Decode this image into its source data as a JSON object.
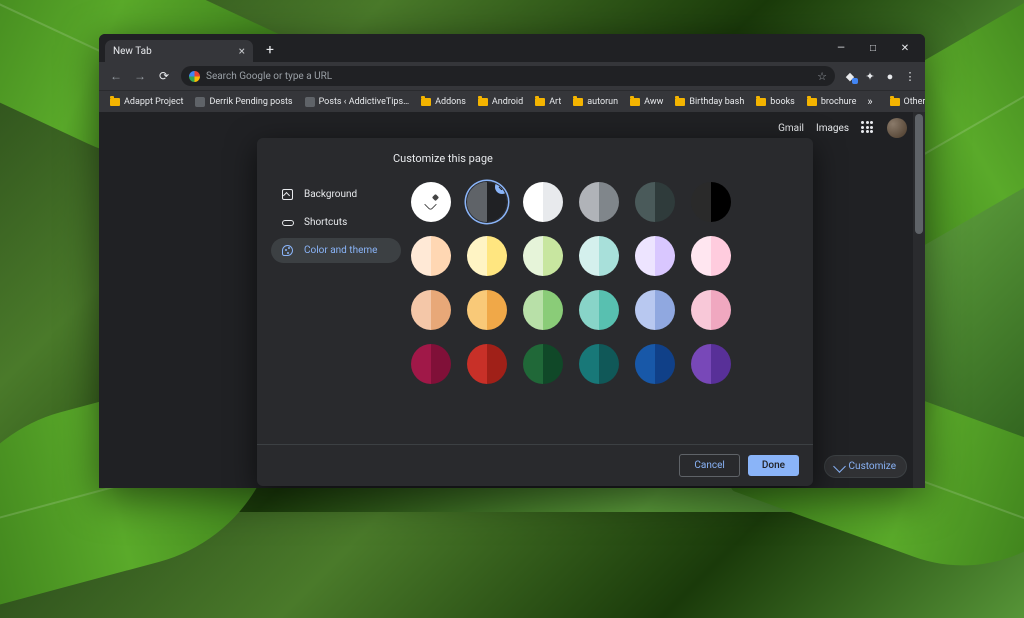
{
  "tab": {
    "title": "New Tab",
    "close": "×"
  },
  "new_tab_plus": "+",
  "win": {
    "min": "—",
    "max": "□",
    "close": "✕"
  },
  "omnibox": {
    "placeholder": "Search Google or type a URL"
  },
  "bookmarks": [
    {
      "label": "Adappt Project",
      "type": "folder"
    },
    {
      "label": "Derrik Pending posts",
      "type": "site"
    },
    {
      "label": "Posts ‹ AddictiveTips…",
      "type": "site"
    },
    {
      "label": "Addons",
      "type": "folder"
    },
    {
      "label": "Android",
      "type": "folder"
    },
    {
      "label": "Art",
      "type": "folder"
    },
    {
      "label": "autorun",
      "type": "folder"
    },
    {
      "label": "Aww",
      "type": "folder"
    },
    {
      "label": "Birthday bash",
      "type": "folder"
    },
    {
      "label": "books",
      "type": "folder"
    },
    {
      "label": "brochure",
      "type": "folder"
    }
  ],
  "bookmarks_overflow": "»",
  "other_bookmarks": "Other bookmarks",
  "top_links": {
    "gmail": "Gmail",
    "images": "Images"
  },
  "customize_button": "Customize",
  "dialog": {
    "title": "Customize this page",
    "sidebar": [
      {
        "label": "Background",
        "icon": "bg"
      },
      {
        "label": "Shortcuts",
        "icon": "link"
      },
      {
        "label": "Color and theme",
        "icon": "palette",
        "active": true
      }
    ],
    "cancel": "Cancel",
    "done": "Done"
  },
  "swatches": [
    {
      "type": "picker"
    },
    {
      "l": "#5f6368",
      "r": "#202124",
      "selected": true
    },
    {
      "l": "#ffffff",
      "r": "#e8eaed"
    },
    {
      "l": "#b0b3b8",
      "r": "#80868b"
    },
    {
      "l": "#4a5a5a",
      "r": "#2f3b3b"
    },
    {
      "l": "#2a2a2a",
      "r": "#000000"
    },
    {
      "l": "#ffe9d6",
      "r": "#ffd7b3"
    },
    {
      "l": "#fff4c4",
      "r": "#ffe680"
    },
    {
      "l": "#e6f4d9",
      "r": "#c8e6a0"
    },
    {
      "l": "#d4f0ed",
      "r": "#a8e0da"
    },
    {
      "l": "#ede4ff",
      "r": "#d9c7ff"
    },
    {
      "l": "#ffe6f0",
      "r": "#ffccde"
    },
    {
      "l": "#f4c7a8",
      "r": "#e8a878"
    },
    {
      "l": "#f9c978",
      "r": "#f0a848"
    },
    {
      "l": "#b8e0a8",
      "r": "#8acc78"
    },
    {
      "l": "#88d4c8",
      "r": "#58c0b0"
    },
    {
      "l": "#b8c8f0",
      "r": "#90a8e0"
    },
    {
      "l": "#f8c8d8",
      "r": "#f0a8c0"
    },
    {
      "l": "#a01848",
      "r": "#801038"
    },
    {
      "l": "#c83028",
      "r": "#a02018"
    },
    {
      "l": "#206838",
      "r": "#104828"
    },
    {
      "l": "#187878",
      "r": "#105858"
    },
    {
      "l": "#1858a8",
      "r": "#104088"
    },
    {
      "l": "#7848b8",
      "r": "#583098"
    }
  ]
}
